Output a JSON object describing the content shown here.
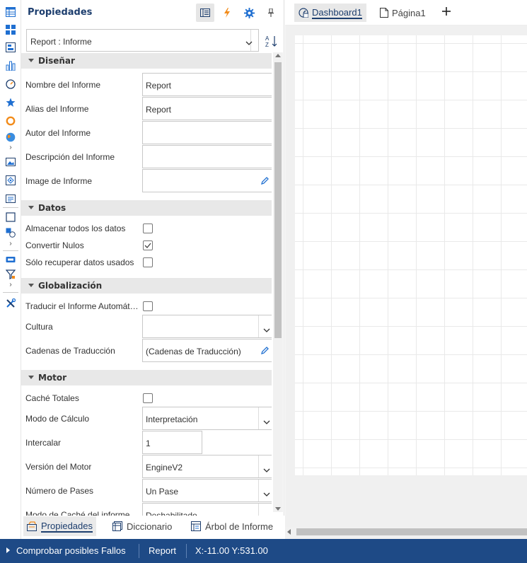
{
  "toolbar": {
    "icons": [
      "table-icon",
      "grid-icon",
      "pivot-icon",
      "chart-icon",
      "gauge-icon",
      "star-icon",
      "ring-icon",
      "map-icon",
      "image-icon",
      "region-map-icon",
      "text-icon",
      "shape-icon",
      "shapes-icon",
      "button-icon",
      "filter-icon",
      "tools-icon"
    ]
  },
  "props": {
    "title": "Propiedades",
    "selected_object": "Report : Informe",
    "categories": {
      "design": "Diseñar",
      "data": "Datos",
      "globalization": "Globalización",
      "engine": "Motor"
    },
    "fields": {
      "report_name": {
        "label": "Nombre del Informe",
        "value": "Report"
      },
      "report_alias": {
        "label": "Alias del Informe",
        "value": "Report"
      },
      "report_author": {
        "label": "Autor del Informe",
        "value": ""
      },
      "report_description": {
        "label": "Descripción del Informe",
        "value": ""
      },
      "report_image": {
        "label": "Image de Informe",
        "value": ""
      },
      "cache_all_data": {
        "label": "Almacenar todos los datos",
        "checked": false
      },
      "convert_nulls": {
        "label": "Convertir Nulos",
        "checked": true
      },
      "retrieve_only_used": {
        "label": "Sólo recuperar datos usados",
        "checked": false
      },
      "auto_localize": {
        "label": "Traducir el Informe Automát…",
        "checked": false
      },
      "culture": {
        "label": "Cultura",
        "value": ""
      },
      "translation_strings": {
        "label": "Cadenas de Traducción",
        "value": "(Cadenas de Traducción)"
      },
      "cache_totals": {
        "label": "Caché Totales",
        "checked": false
      },
      "calculation_mode": {
        "label": "Modo de Cálculo",
        "value": "Interpretación"
      },
      "collate": {
        "label": "Intercalar",
        "value": "1"
      },
      "engine_version": {
        "label": "Versión del Motor",
        "value": "EngineV2"
      },
      "number_of_passes": {
        "label": "Número de Pases",
        "value": "Un Pase"
      },
      "report_cache_mode": {
        "label": "Modo de Caché del informe",
        "value": "Deshabilitado"
      }
    },
    "bottom_tabs": {
      "properties": "Propiedades",
      "dictionary": "Diccionario",
      "report_tree": "Árbol de Informe"
    }
  },
  "canvas": {
    "tabs": {
      "dashboard": "Dashboard1",
      "page": "Página1"
    }
  },
  "status": {
    "check_issues": "Comprobar posibles Fallos",
    "report": "Report",
    "coords": "X:-11.00 Y:531.00"
  },
  "colors": {
    "accent": "#1d3e6e",
    "statusbar": "#1e4a86",
    "icon_blue": "#1f6fd1",
    "icon_orange": "#f28b1a"
  }
}
